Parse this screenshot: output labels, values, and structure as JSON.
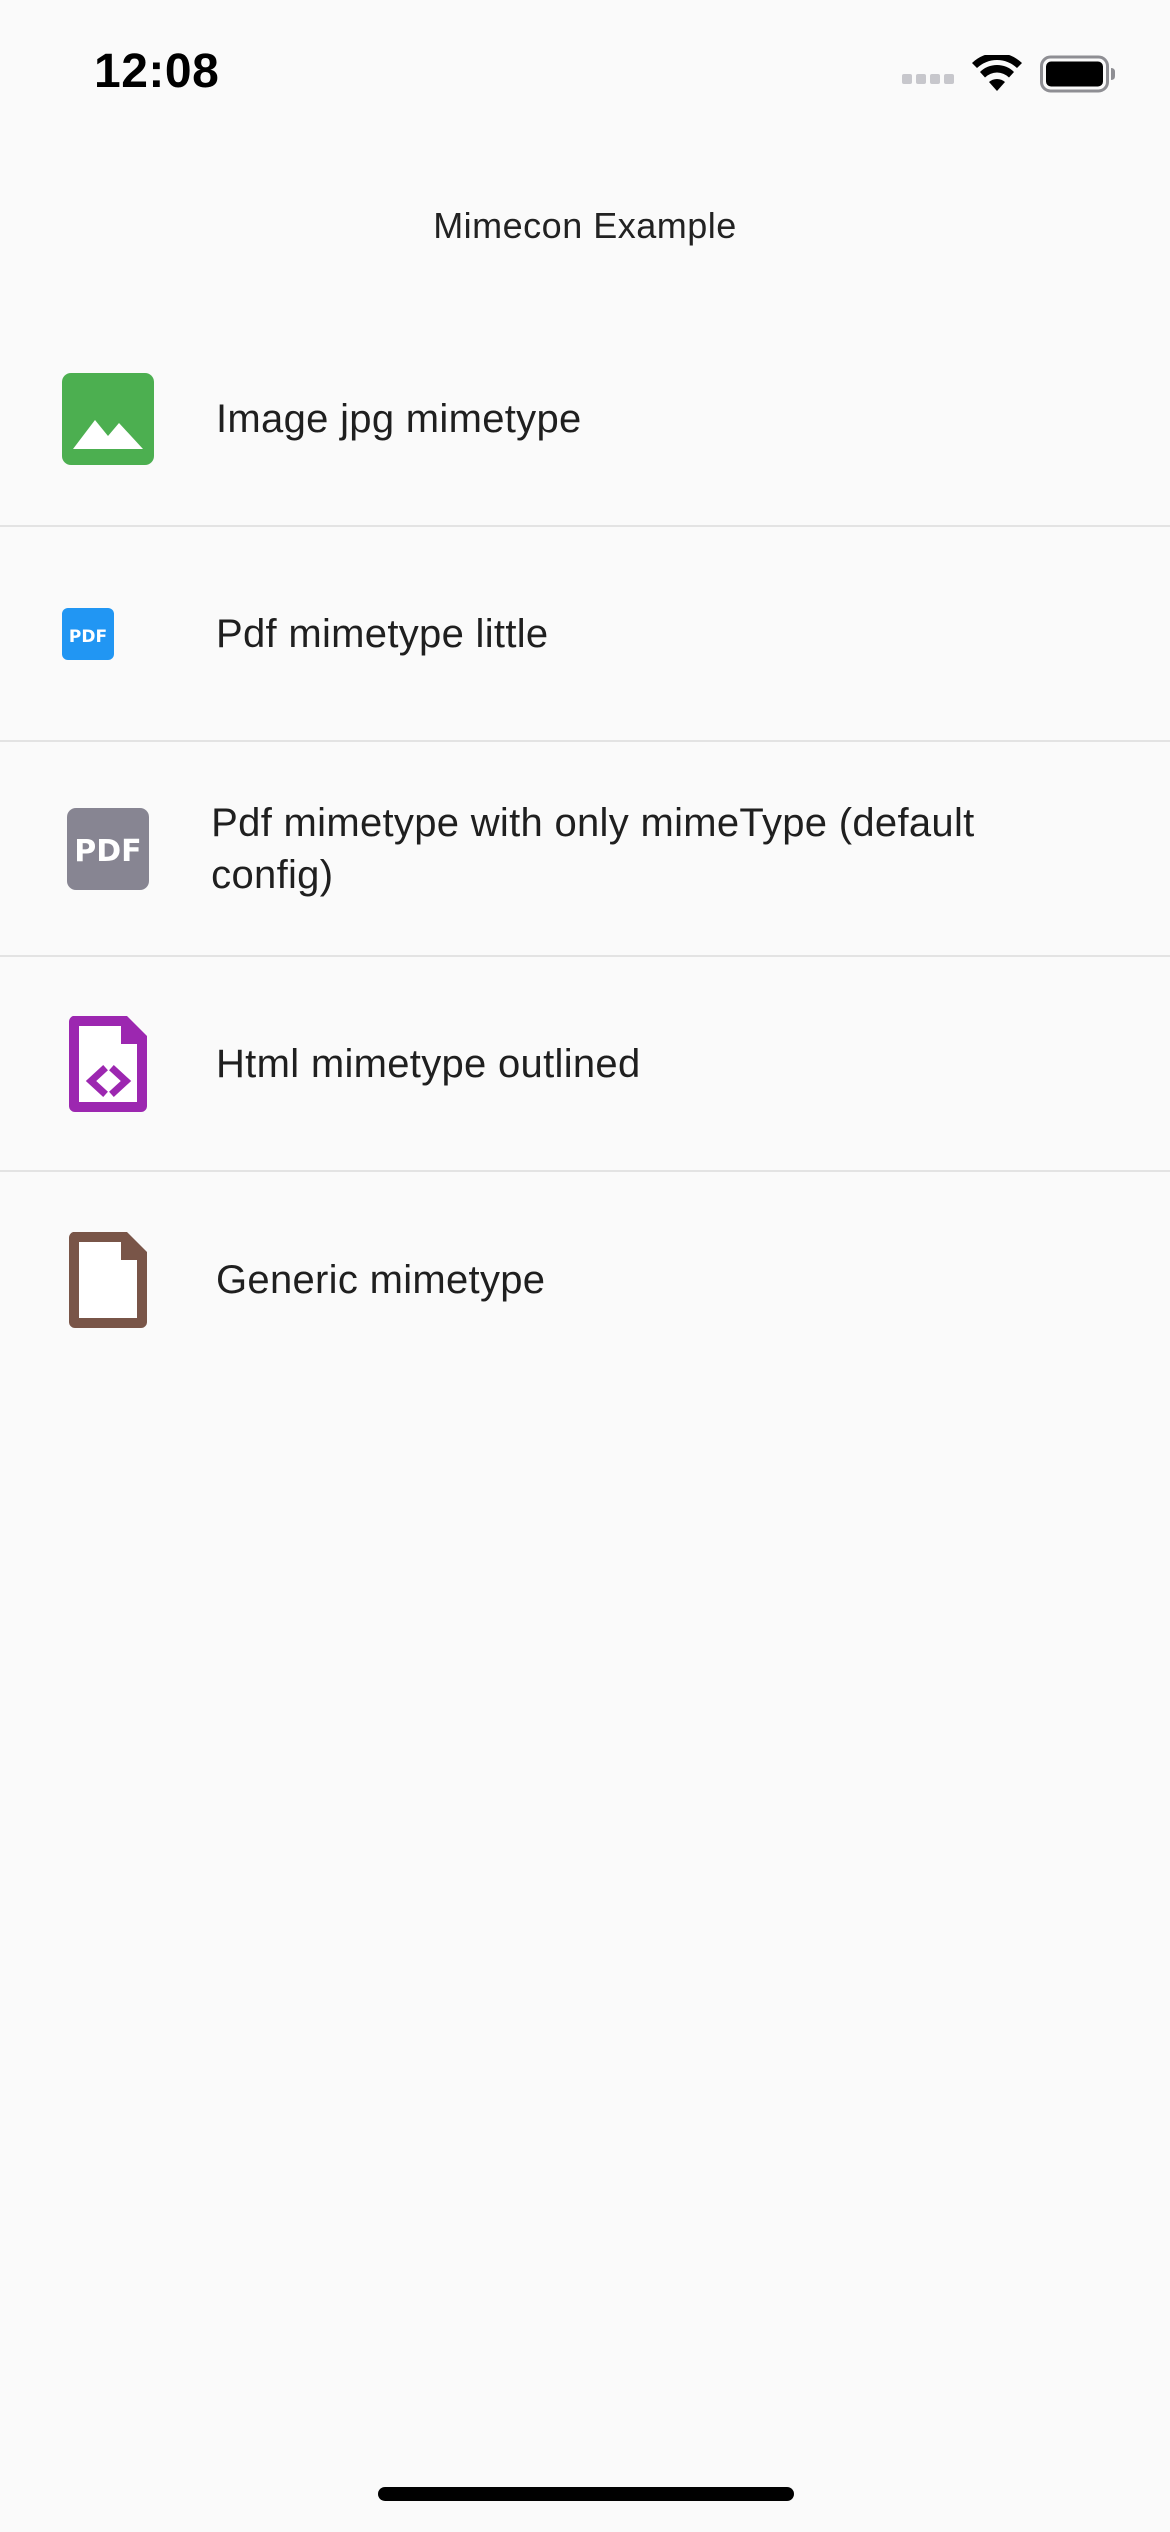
{
  "status_bar": {
    "time": "12:08",
    "icons": [
      "signal-icon",
      "wifi-icon",
      "battery-icon"
    ]
  },
  "app_bar": {
    "title": "Mimecon Example"
  },
  "list": {
    "items": [
      {
        "label": "Image jpg mimetype",
        "icon": "image-icon",
        "color": "#4CAF50"
      },
      {
        "label": "Pdf mimetype little",
        "icon": "pdf-icon",
        "color": "#2196F3",
        "icon_text": "PDF"
      },
      {
        "label": "Pdf mimetype with only mimeType (default config)",
        "icon": "pdf-icon",
        "color": "#878592",
        "icon_text": "PDF"
      },
      {
        "label": "Html mimetype outlined",
        "icon": "html-code-file-icon",
        "color": "#9C27B0"
      },
      {
        "label": "Generic mimetype",
        "icon": "generic-file-icon",
        "color": "#795548"
      }
    ]
  }
}
